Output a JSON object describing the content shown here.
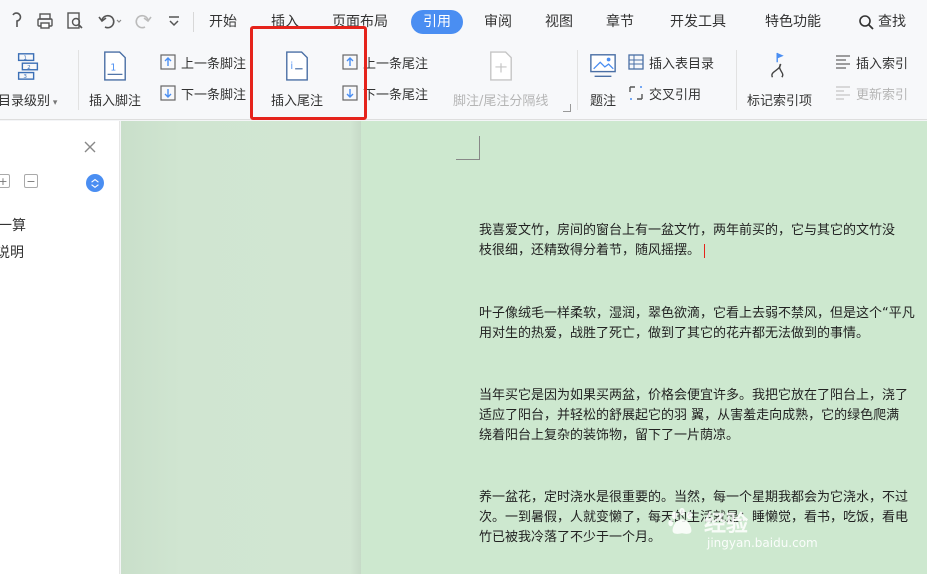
{
  "menubar": {
    "tabs": [
      "开始",
      "插入",
      "页面布局",
      "引用",
      "审阅",
      "视图",
      "章节",
      "开发工具",
      "特色功能"
    ],
    "active_tab": "引用",
    "search_label": "查找"
  },
  "ribbon": {
    "toc_level": "目录级别",
    "insert_footnote": "插入脚注",
    "prev_footnote": "上一条脚注",
    "next_footnote": "下一条脚注",
    "insert_endnote": "插入尾注",
    "prev_endnote": "上一条尾注",
    "next_endnote": "下一条尾注",
    "separator": "脚注/尾注分隔线",
    "caption": "题注",
    "insert_table_toc": "插入表目录",
    "cross_ref": "交叉引用",
    "mark_index": "标记索引项",
    "insert_index": "插入索引",
    "update_index": "更新索引"
  },
  "navpane": {
    "items": [
      "一算",
      "说明"
    ]
  },
  "document": {
    "paragraphs": [
      [
        "我喜爱文竹，房间的窗台上有一盆文竹，两年前买的，它与其它的文竹没",
        "枝很细，还精致得分着节，随风摇摆。"
      ],
      [
        "叶子像绒毛一样柔软，湿润，翠色欲滴，它看上去弱不禁风，但是这个“平凡",
        "用对生的热爱，战胜了死亡，做到了其它的花卉都无法做到的事情。"
      ],
      [
        "当年买它是因为如果买两盆，价格会便宜许多。我把它放在了阳台上，浇了",
        "适应了阳台，并轻松的舒展起它的羽 翼，从害羞走向成熟，它的绿色爬满",
        "绕着阳台上复杂的装饰物，留下了一片荫凉。"
      ],
      [
        "养一盆花，定时浇水是很重要的。当然，每一个星期我都会为它浇水，不过",
        "次。一到暑假，人就变懒了，每天的生活就是：睡懒觉，看书，吃饭，看电",
        "竹已被我冷落了不少于一个月。"
      ]
    ]
  },
  "watermark": {
    "name": "经验",
    "url": "jingyan.baidu.com"
  },
  "colors": {
    "accent": "#4a8ef2",
    "highlight": "#e5231b",
    "doc_bg": "#cde8cf"
  }
}
